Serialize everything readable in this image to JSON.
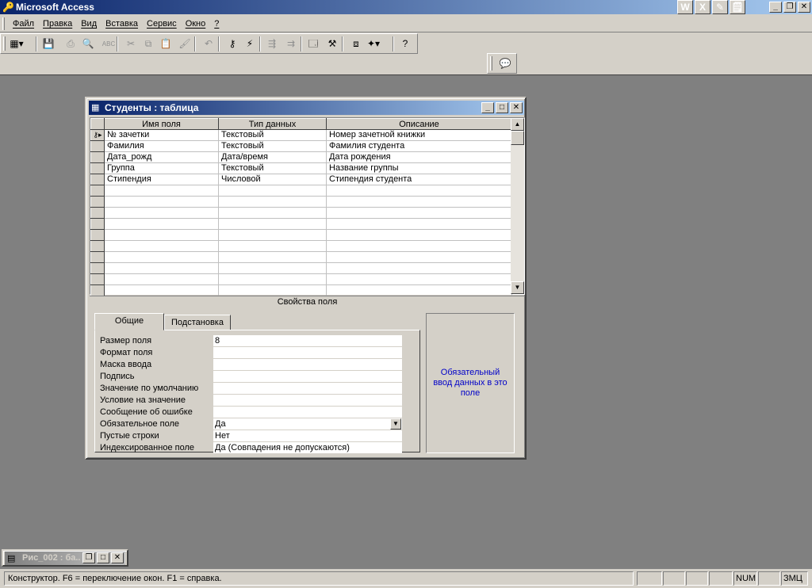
{
  "app": {
    "title": "Microsoft Access"
  },
  "office_bar": [
    "W",
    "X",
    "✎",
    "🗒"
  ],
  "menu": [
    "Файл",
    "Правка",
    "Вид",
    "Вставка",
    "Сервис",
    "Окно",
    "?"
  ],
  "toolbar": {
    "buttons": [
      {
        "name": "view-button",
        "glyph": "▦▾"
      },
      {
        "name": "save-button",
        "glyph": "💾"
      },
      {
        "name": "print-button",
        "glyph": "⎙"
      },
      {
        "name": "print-preview-button",
        "glyph": "🔍"
      },
      {
        "name": "spelling-button",
        "glyph": "ABC"
      },
      {
        "name": "cut-button",
        "glyph": "✂"
      },
      {
        "name": "copy-button",
        "glyph": "⧉"
      },
      {
        "name": "paste-button",
        "glyph": "📋"
      },
      {
        "name": "format-painter-button",
        "glyph": "🖌"
      },
      {
        "name": "undo-button",
        "glyph": "↶"
      },
      {
        "name": "primary-key-button",
        "glyph": "⚷"
      },
      {
        "name": "indexes-button",
        "glyph": "⚡"
      },
      {
        "name": "insert-rows-button",
        "glyph": "⇶"
      },
      {
        "name": "delete-rows-button",
        "glyph": "⇉"
      },
      {
        "name": "properties-button",
        "glyph": "🗔"
      },
      {
        "name": "build-button",
        "glyph": "⚒"
      },
      {
        "name": "database-window-button",
        "glyph": "⧈"
      },
      {
        "name": "new-object-button",
        "glyph": "✦▾"
      },
      {
        "name": "help-button",
        "glyph": "?"
      }
    ]
  },
  "table_window": {
    "title": "Студенты : таблица",
    "columns": [
      "Имя поля",
      "Тип данных",
      "Описание"
    ],
    "rows": [
      {
        "key": true,
        "name": "№ зачетки",
        "type": "Текстовый",
        "desc": "Номер зачетной книжки"
      },
      {
        "key": false,
        "name": "Фамилия",
        "type": "Текстовый",
        "desc": "Фамилия студента"
      },
      {
        "key": false,
        "name": "Дата_рожд",
        "type": "Дата/время",
        "desc": "Дата рождения"
      },
      {
        "key": false,
        "name": "Группа",
        "type": "Текстовый",
        "desc": "Название группы"
      },
      {
        "key": false,
        "name": "Стипендия",
        "type": "Числовой",
        "desc": "Стипендия студента"
      }
    ],
    "empty_rows": 10,
    "props_label": "Свойства поля",
    "tabs": [
      "Общие",
      "Подстановка"
    ],
    "properties": [
      {
        "label": "Размер поля",
        "value": "8",
        "dropdown": false
      },
      {
        "label": "Формат поля",
        "value": "",
        "dropdown": false
      },
      {
        "label": "Маска ввода",
        "value": "",
        "dropdown": false
      },
      {
        "label": "Подпись",
        "value": "",
        "dropdown": false
      },
      {
        "label": "Значение по умолчанию",
        "value": "",
        "dropdown": false
      },
      {
        "label": "Условие на значение",
        "value": "",
        "dropdown": false
      },
      {
        "label": "Сообщение об ошибке",
        "value": "",
        "dropdown": false
      },
      {
        "label": "Обязательное поле",
        "value": "Да",
        "dropdown": true
      },
      {
        "label": "Пустые строки",
        "value": "Нет",
        "dropdown": false
      },
      {
        "label": "Индексированное поле",
        "value": "Да (Совпадения не допускаются)",
        "dropdown": false
      }
    ],
    "help_text": "Обязательный ввод данных в это поле"
  },
  "minimized_window": {
    "title": "Рис_002 : ба..."
  },
  "status": {
    "text": "Конструктор.  F6 = переключение окон.  F1 = справка.",
    "num": "NUM",
    "zmc": "ЗМЦ"
  }
}
